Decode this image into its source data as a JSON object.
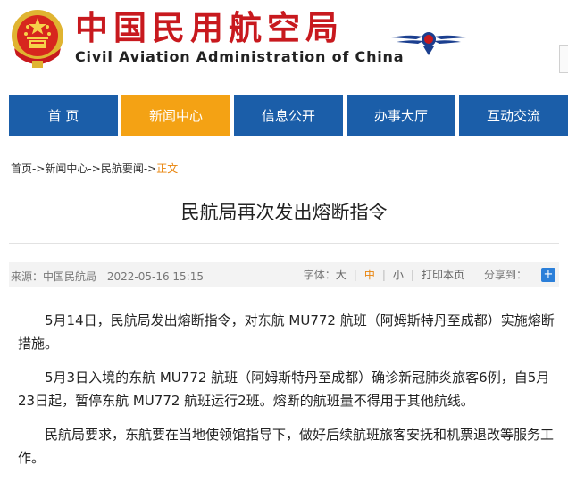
{
  "header": {
    "title_cn": "中国民用航空局",
    "title_en": "Civil Aviation Administration of China",
    "emblem_icon": "national-emblem-icon",
    "logo_icon": "caac-wings-logo-icon",
    "brand_color": "#c8191e"
  },
  "nav": {
    "items": [
      {
        "label": "首 页"
      },
      {
        "label": "新闻中心"
      },
      {
        "label": "信息公开"
      },
      {
        "label": "办事大厅"
      },
      {
        "label": "互动交流"
      }
    ],
    "active_index": 1,
    "color": "#1b5ea9",
    "active_color": "#f4a214"
  },
  "breadcrumb": {
    "items": [
      "首页",
      "新闻中心",
      "民航要闻"
    ],
    "separator": "->",
    "current": "正文"
  },
  "article": {
    "title": "民航局再次发出熔断指令",
    "source": "来源：中国民航局",
    "date": "2022-05-16 15:15",
    "font_size_label": "字体：",
    "font_sizes": [
      "大",
      "中",
      "小"
    ],
    "active_font_size": "中",
    "print_label": "打印本页",
    "share_label": "分享到：",
    "share_icon": "plus-share-icon",
    "paragraphs": [
      "5月14日，民航局发出熔断指令，对东航 MU772 航班（阿姆斯特丹至成都）实施熔断措施。",
      "5月3日入境的东航 MU772 航班（阿姆斯特丹至成都）确诊新冠肺炎旅客6例，自5月23日起，暂停东航 MU772 航班运行2班。熔断的航班量不得用于其他航线。",
      "民航局要求，东航要在当地使领馆指导下，做好后续航班旅客安抚和机票退改等服务工作。"
    ]
  }
}
